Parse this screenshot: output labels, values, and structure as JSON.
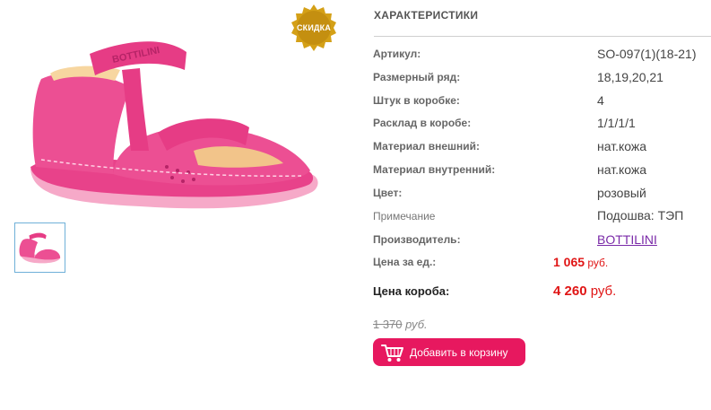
{
  "badge": {
    "label": "СКИДКА"
  },
  "characteristics": {
    "title": "ХАРАКТЕРИСТИКИ",
    "rows": [
      {
        "label": "Артикул:",
        "value": "SO-097(1)(18-21)"
      },
      {
        "label": "Размерный ряд:",
        "value": "18,19,20,21"
      },
      {
        "label": "Штук в коробке:",
        "value": "4"
      },
      {
        "label": "Расклад в коробе:",
        "value": "1/1/1/1"
      },
      {
        "label": "Материал внешний:",
        "value": "нат.кожа"
      },
      {
        "label": "Материал внутренний:",
        "value": "нат.кожа"
      },
      {
        "label": "Цвет:",
        "value": "розовый"
      },
      {
        "label": "Примечание",
        "value": "Подошва: ТЭП"
      },
      {
        "label": "Производитель:",
        "value": "BOTTILINI"
      }
    ]
  },
  "prices": {
    "unit_label": "Цена за ед.:",
    "unit_value": "1 065",
    "unit_currency": " руб.",
    "box_label": "Цена короба:",
    "box_value": "4 260",
    "box_currency": " руб.",
    "old_value": "1 370",
    "old_currency": " руб."
  },
  "actions": {
    "add_to_cart": "Добавить в корзину"
  },
  "product": {
    "strap_text": "BOTTILINI"
  },
  "colors": {
    "accent": "#e7185f",
    "price": "#e01515",
    "badge": "#d4a017",
    "shoe": "#ec4f93"
  },
  "icons": {
    "cart": "cart-icon",
    "badge": "sale-badge-icon"
  }
}
